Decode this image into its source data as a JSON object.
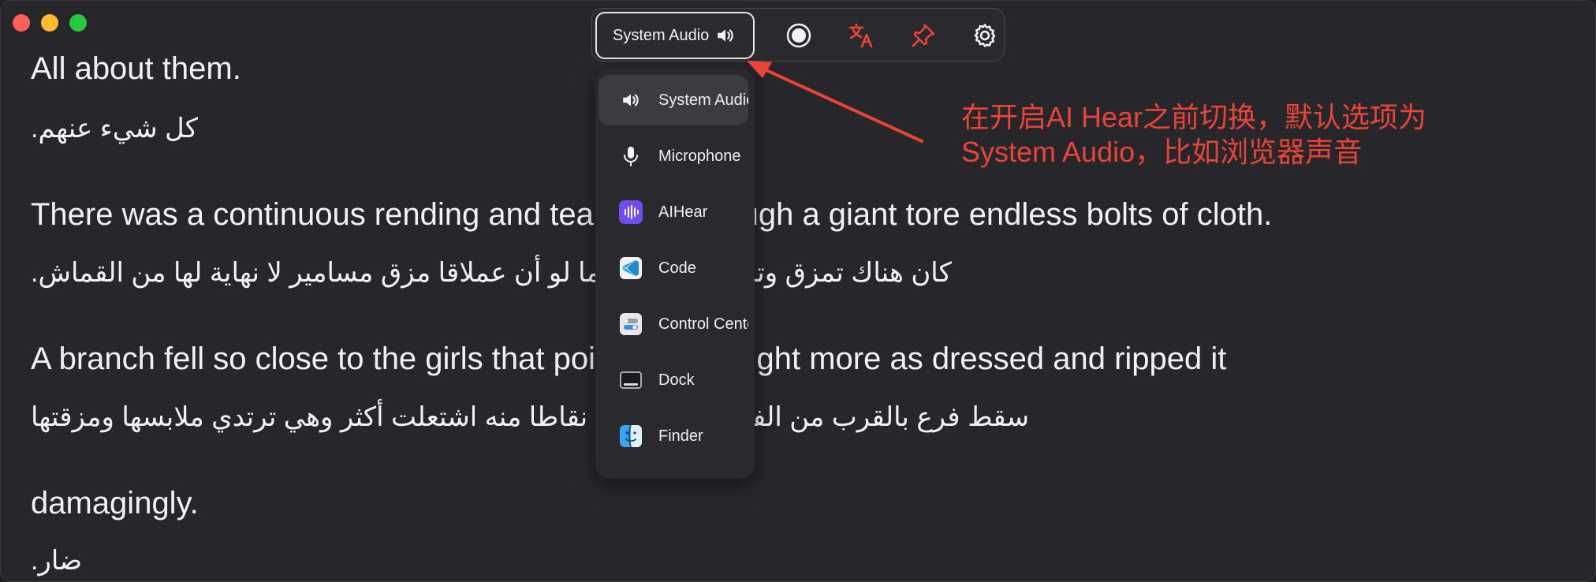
{
  "window": {
    "controls": [
      "close",
      "minimize",
      "zoom"
    ]
  },
  "transcript": [
    {
      "en": "All about them.",
      "ar": "كل شيء عنهم."
    },
    {
      "en": "There was a continuous rending and tearing as though a giant tore endless bolts of cloth.",
      "ar": "كان هناك تمزق وتمزق مستمر كما لو أن عملاقا مزق مسامير لا نهاية لها من القماش."
    },
    {
      "en": "A branch fell so close to the girls that points of it caught more as dressed and ripped it",
      "ar": "سقط فرع بالقرب من الفتيات لدرجة أن نقاطا منه اشتعلت أكثر وهي ترتدي ملابسها ومزقتها"
    },
    {
      "en": "damagingly.",
      "ar": "ضار."
    }
  ],
  "toolbar": {
    "source_label": "System Audio",
    "source_icon": "speaker-icon",
    "icons": [
      "record-icon",
      "translate-icon",
      "pin-icon",
      "gear-icon"
    ],
    "accent_color": "#e8453a"
  },
  "dropdown": {
    "items": [
      {
        "label": "System Audio",
        "icon": "speaker-icon",
        "active": true
      },
      {
        "label": "Microphone",
        "icon": "microphone-icon",
        "active": false
      },
      {
        "label": "AIHear",
        "icon": "aihear-app-icon",
        "active": false
      },
      {
        "label": "Code",
        "icon": "vscode-app-icon",
        "active": false
      },
      {
        "label": "Control Center",
        "icon": "control-center-app-icon",
        "active": false
      },
      {
        "label": "Dock",
        "icon": "dock-app-icon",
        "active": false
      },
      {
        "label": "Finder",
        "icon": "finder-app-icon",
        "active": false
      }
    ]
  },
  "annotation": {
    "line1": "在开启AI Hear之前切换，默认选项为",
    "line2": "System Audio，比如浏览器声音",
    "color": "#e8453a"
  }
}
